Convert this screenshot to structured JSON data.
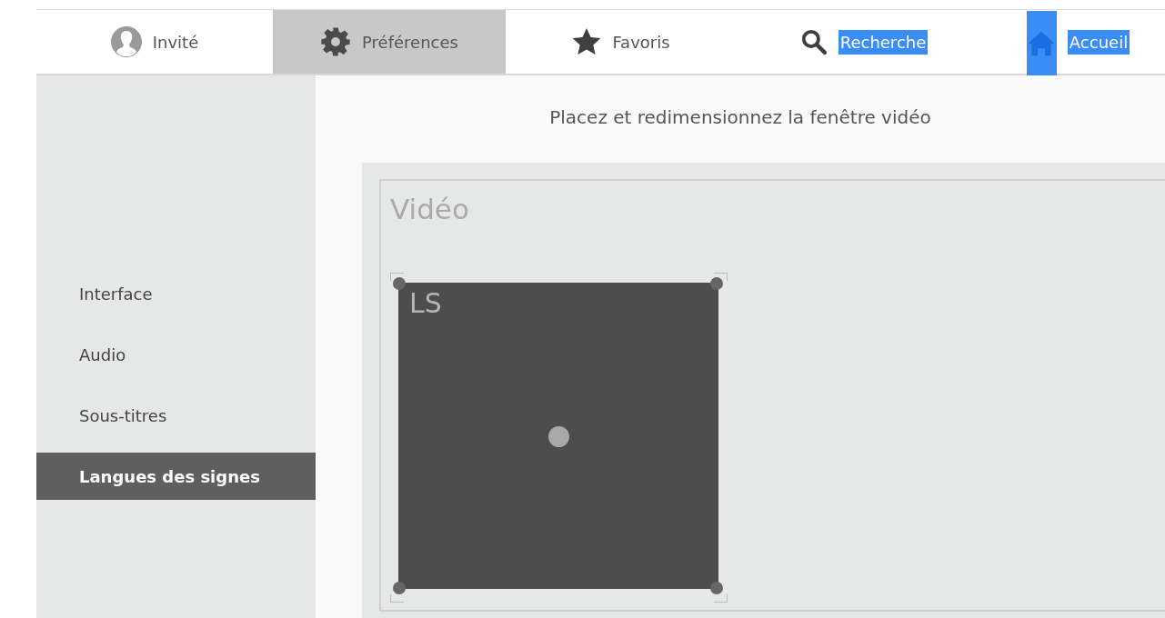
{
  "nav_tabs": [
    {
      "label": "Invité",
      "selected": false,
      "highlighted": false
    },
    {
      "label": "Préférences",
      "selected": true,
      "highlighted": false
    },
    {
      "label": "Favoris",
      "selected": false,
      "highlighted": false
    },
    {
      "label": "Recherche",
      "selected": false,
      "highlighted": true
    },
    {
      "label": "Accueil",
      "selected": false,
      "highlighted": true
    }
  ],
  "sidebar": {
    "items": [
      {
        "label": "Interface",
        "selected": false
      },
      {
        "label": "Audio",
        "selected": false
      },
      {
        "label": "Sous-titres",
        "selected": false
      },
      {
        "label": "Langues des signes",
        "selected": true
      }
    ]
  },
  "content": {
    "title": "Placez et redimensionnez la fenêtre vidéo",
    "video_area": {
      "label": "Vidéo",
      "window": {
        "label": "LS"
      }
    }
  }
}
